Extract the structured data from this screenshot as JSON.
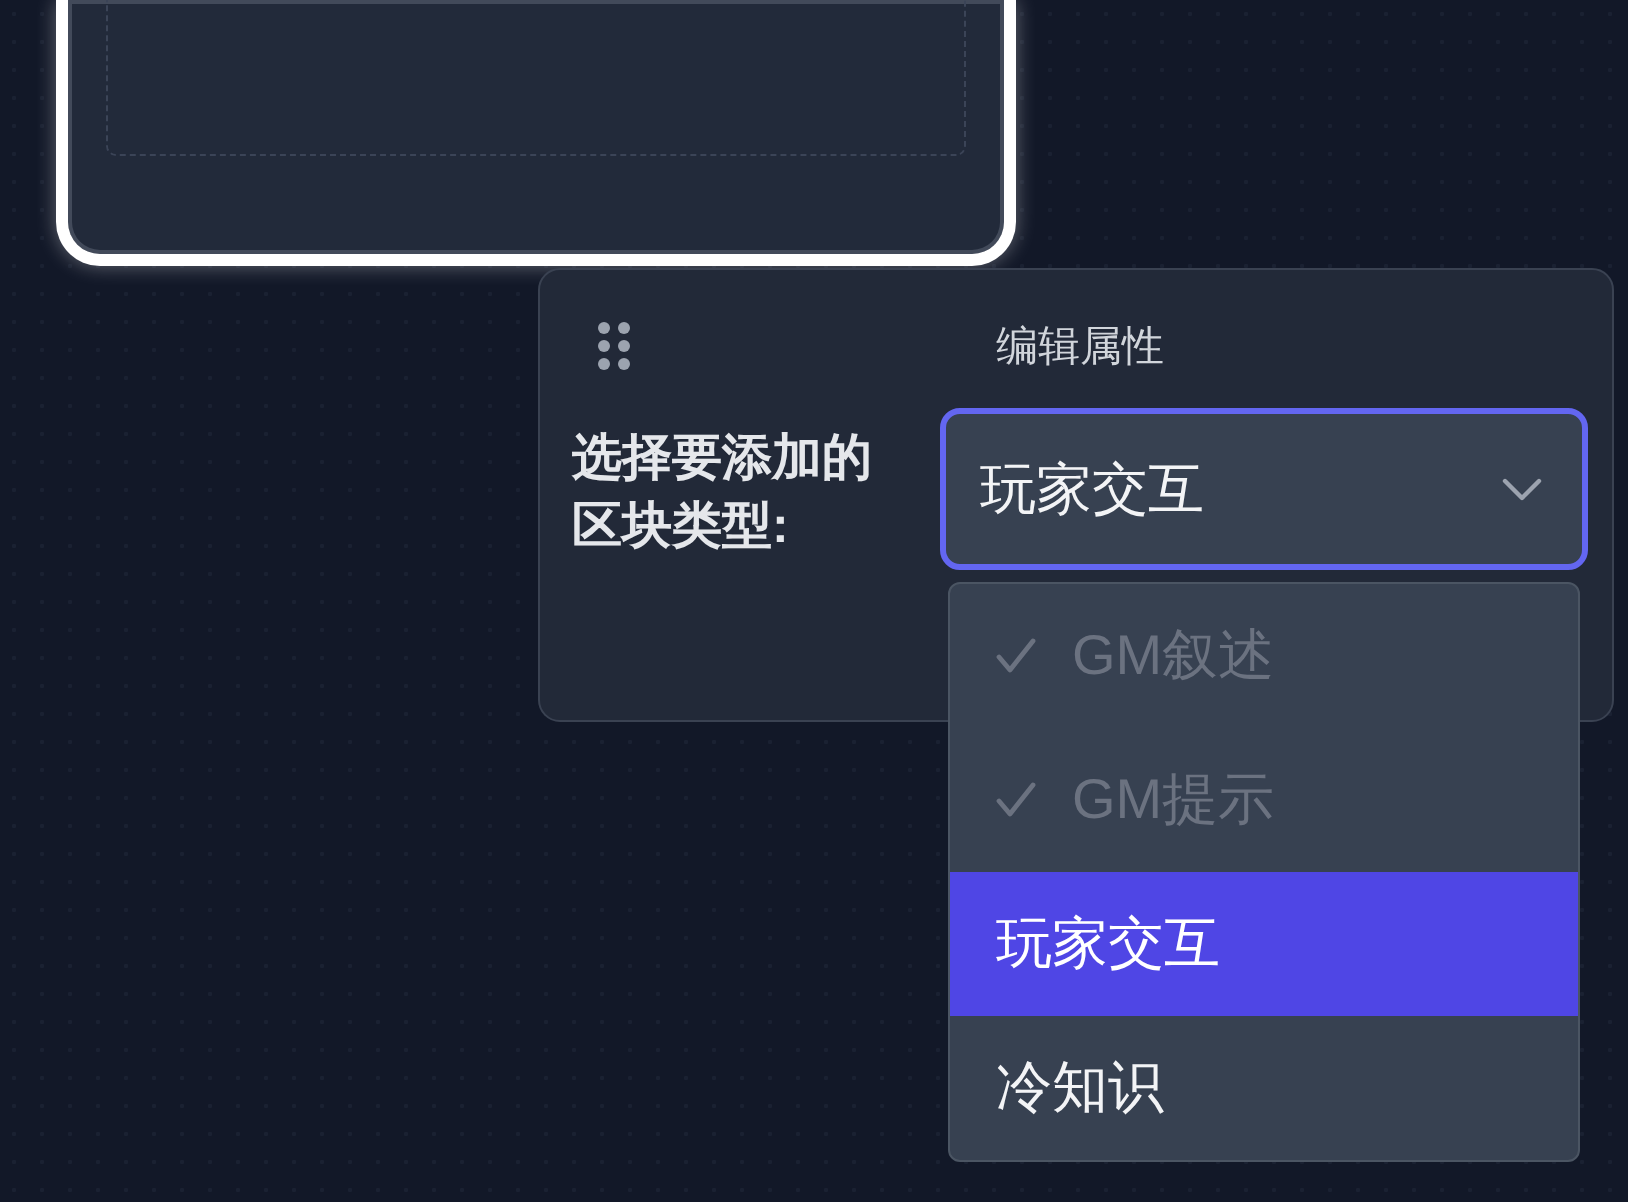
{
  "panel": {
    "title": "编辑属性",
    "field": {
      "label": "选择要添加的区块类型:",
      "value": "玩家交互",
      "focused": true
    },
    "options": [
      {
        "label": "GM叙述",
        "checked": true,
        "disabled": true,
        "selected": false
      },
      {
        "label": "GM提示",
        "checked": true,
        "disabled": true,
        "selected": false
      },
      {
        "label": "玩家交互",
        "checked": false,
        "disabled": false,
        "selected": true
      },
      {
        "label": "冷知识",
        "checked": false,
        "disabled": false,
        "selected": false
      }
    ]
  }
}
